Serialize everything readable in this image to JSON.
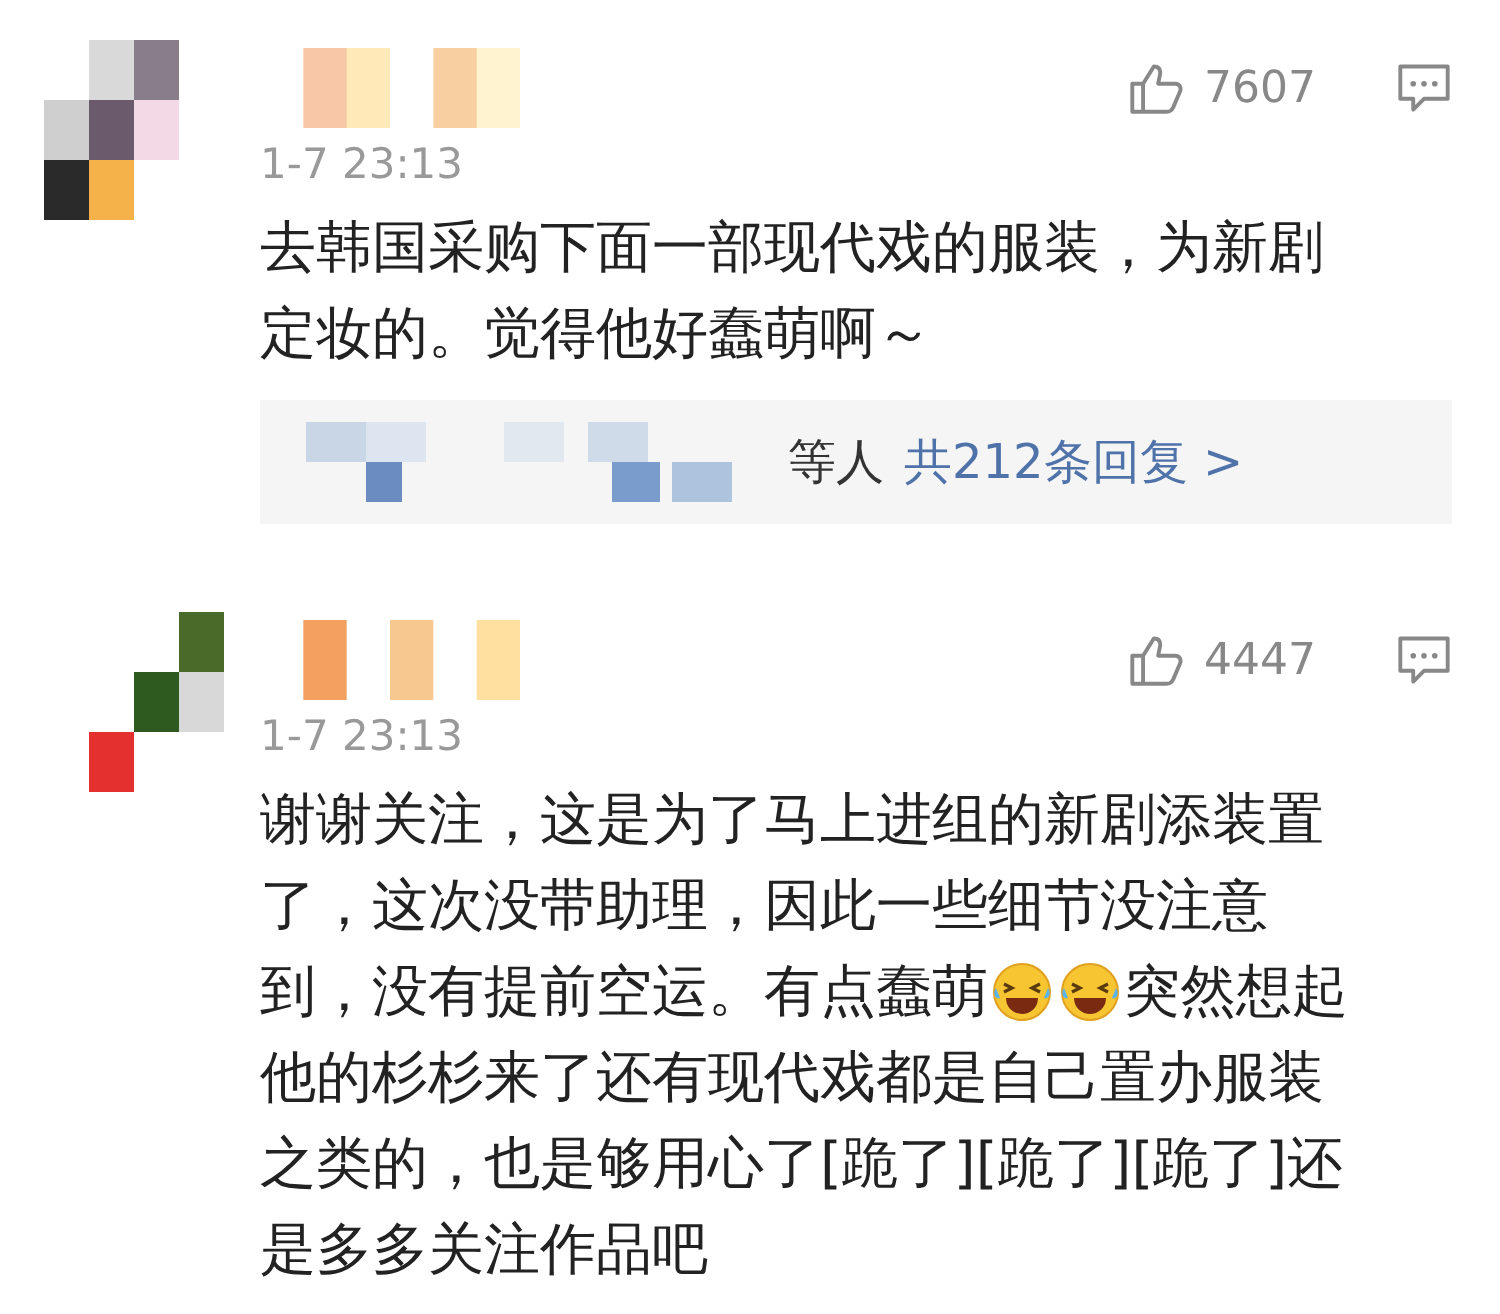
{
  "comments": [
    {
      "time": "1-7 23:13",
      "likes": "7607",
      "lines": [
        [
          {
            "kind": "text",
            "text": "去韩国采购下面一部现代戏的服装，为新剧"
          }
        ],
        [
          {
            "kind": "text",
            "text": "定妆的。觉得他好蠢萌啊～"
          }
        ]
      ],
      "replies": {
        "suffix": "等人",
        "link": "共212条回复 >"
      }
    },
    {
      "time": "1-7 23:13",
      "likes": "4447",
      "lines": [
        [
          {
            "kind": "text",
            "text": "谢谢关注，这是为了马上进组的新剧添装置"
          }
        ],
        [
          {
            "kind": "text",
            "text": "了，这次没带助理，因此一些细节没注意"
          }
        ],
        [
          {
            "kind": "text",
            "text": "到，没有提前空运。有点蠢萌"
          },
          {
            "kind": "emoji"
          },
          {
            "kind": "emoji"
          },
          {
            "kind": "text",
            "text": "突然想起"
          }
        ],
        [
          {
            "kind": "text",
            "text": "他的杉杉来了还有现代戏都是自己置办服装"
          }
        ],
        [
          {
            "kind": "text",
            "text": "之类的，也是够用心了[跪了][跪了][跪了]还"
          }
        ],
        [
          {
            "kind": "text",
            "text": "是多多关注作品吧"
          }
        ]
      ]
    }
  ]
}
